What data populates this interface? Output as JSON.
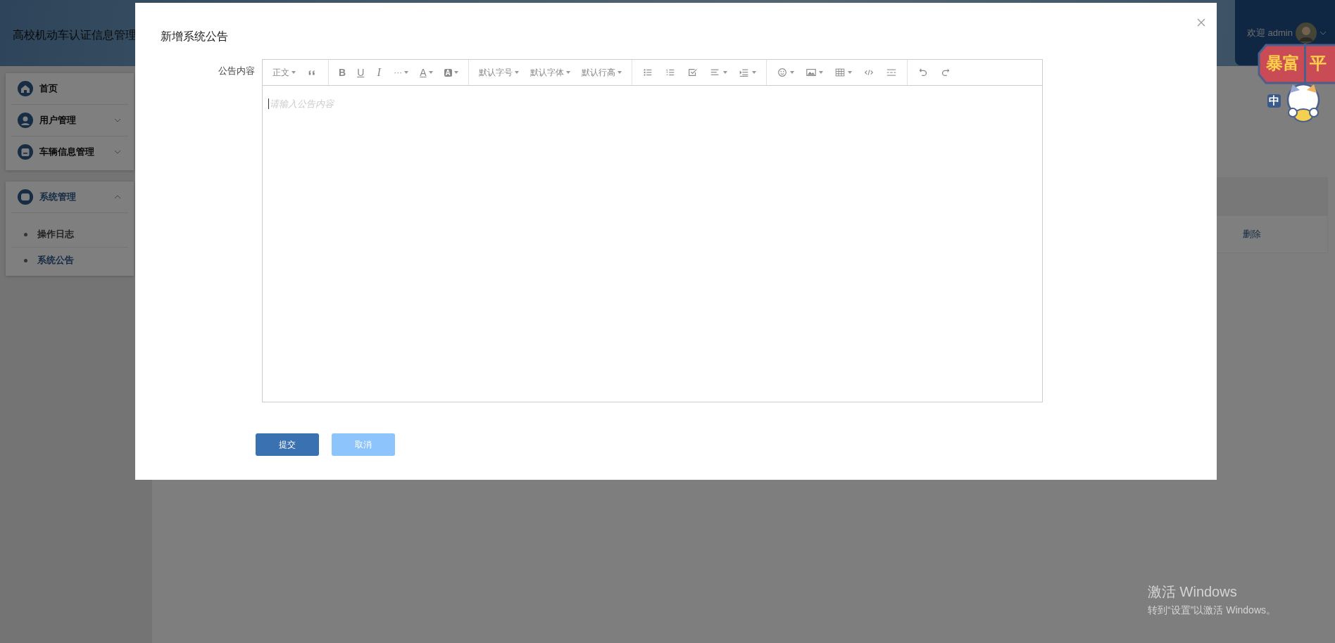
{
  "header": {
    "title": "高校机动车认证信息管理",
    "welcome": "欢迎 admin"
  },
  "sidebar": {
    "groups": [
      {
        "items": [
          {
            "label": "首页",
            "kind": "home",
            "expanded": false,
            "has_children": false
          },
          {
            "label": "用户管理",
            "kind": "user",
            "expanded": false,
            "has_children": true
          },
          {
            "label": "车辆信息管理",
            "kind": "car",
            "expanded": false,
            "has_children": true
          }
        ]
      },
      {
        "items": [
          {
            "label": "系统管理",
            "kind": "system",
            "expanded": true,
            "has_children": true,
            "children": [
              {
                "label": "操作日志",
                "selected": false
              },
              {
                "label": "系统公告",
                "selected": true
              }
            ]
          }
        ]
      }
    ]
  },
  "table": {
    "row_actions": [
      "删除"
    ]
  },
  "dialog": {
    "title": "新增系统公告",
    "field_label": "公告内容",
    "placeholder": "请输入公告内容",
    "toolbar": [
      [
        {
          "kind": "menu",
          "label": "正文",
          "dropdown": true
        },
        {
          "kind": "quote",
          "dropdown": false
        }
      ],
      [
        {
          "kind": "bold",
          "label": "B",
          "dropdown": false
        },
        {
          "kind": "underline",
          "label": "U",
          "dropdown": false
        },
        {
          "kind": "italic",
          "label": "I",
          "dropdown": false
        },
        {
          "kind": "glyph",
          "label": "···",
          "dropdown": true
        },
        {
          "kind": "color",
          "label": "A",
          "dropdown": true
        },
        {
          "kind": "highlight",
          "label": "A",
          "dropdown": true
        }
      ],
      [
        {
          "kind": "menu",
          "label": "默认字号",
          "dropdown": true
        },
        {
          "kind": "menu",
          "label": "默认字体",
          "dropdown": true
        },
        {
          "kind": "menu",
          "label": "默认行高",
          "dropdown": true
        }
      ],
      [
        {
          "kind": "bullets",
          "dropdown": false
        },
        {
          "kind": "numbers",
          "dropdown": false
        },
        {
          "kind": "todo",
          "dropdown": false
        },
        {
          "kind": "align",
          "dropdown": true
        },
        {
          "kind": "indent",
          "dropdown": true
        }
      ],
      [
        {
          "kind": "emoji",
          "dropdown": true
        },
        {
          "kind": "image",
          "dropdown": true
        },
        {
          "kind": "table",
          "dropdown": true
        },
        {
          "kind": "code",
          "dropdown": false
        },
        {
          "kind": "divider",
          "dropdown": false
        }
      ],
      [
        {
          "kind": "undo",
          "dropdown": false
        },
        {
          "kind": "redo",
          "dropdown": false
        }
      ]
    ],
    "buttons": [
      {
        "label": "提交",
        "kind": "primary"
      },
      {
        "label": "取消",
        "kind": "secondary"
      }
    ]
  },
  "sticker": {
    "sign": [
      "暴富",
      "平"
    ],
    "ime": "中"
  },
  "activation": {
    "title": "激活 Windows",
    "hint": "转到“设置”以激活 Windows。"
  }
}
